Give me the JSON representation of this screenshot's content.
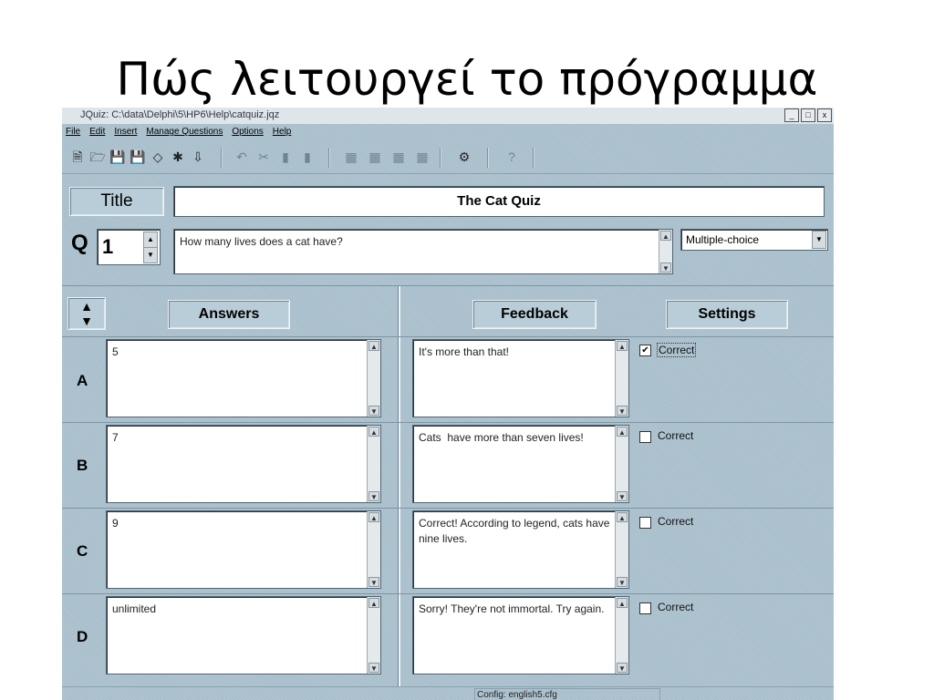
{
  "slide": {
    "title": "Πώς λειτουργεί το πρόγραμμα"
  },
  "window": {
    "title": "JQuiz: C:\\data\\Delphi\\5\\HP6\\Help\\catquiz.jqz",
    "controls": [
      "_",
      "□",
      "x"
    ]
  },
  "menu": [
    "File",
    "Edit",
    "Insert",
    "Manage Questions",
    "Options",
    "Help"
  ],
  "toolbar": [
    {
      "icon": "new-file-icon",
      "glyph": "🗎"
    },
    {
      "icon": "open-folder-icon",
      "glyph": "🗁"
    },
    {
      "icon": "save-icon",
      "glyph": "💾"
    },
    {
      "icon": "save-as-icon",
      "glyph": "💾"
    },
    {
      "icon": "eraser-icon",
      "glyph": "◇"
    },
    {
      "icon": "web-export-icon",
      "glyph": "✱"
    },
    {
      "icon": "download-icon",
      "glyph": "⇩"
    },
    {
      "icon": "undo-icon",
      "glyph": "↶"
    },
    {
      "icon": "cut-icon",
      "glyph": "✂"
    },
    {
      "icon": "copy-icon",
      "glyph": "▮"
    },
    {
      "icon": "paste-icon",
      "glyph": "▮"
    },
    {
      "icon": "add-question-icon",
      "glyph": "▦"
    },
    {
      "icon": "insert-question-icon",
      "glyph": "▦"
    },
    {
      "icon": "delete-question-icon",
      "glyph": "▦"
    },
    {
      "icon": "move-question-icon",
      "glyph": "▦"
    },
    {
      "icon": "config-icon",
      "glyph": "⚙"
    },
    {
      "icon": "help-icon",
      "glyph": "?"
    }
  ],
  "title_label": "Title",
  "title_value": "The Cat Quiz",
  "question": {
    "label": "Q",
    "number": "1",
    "text": "How many lives does a cat have?",
    "type": "Multiple-choice"
  },
  "headers": {
    "answers": "Answers",
    "feedback": "Feedback",
    "settings": "Settings"
  },
  "rows": [
    {
      "letter": "A",
      "answer": "5",
      "feedback": "It's more than that!",
      "correct_label": "Correct",
      "checked": true
    },
    {
      "letter": "B",
      "answer": "7",
      "feedback": "Cats  have more than seven lives!",
      "correct_label": "Correct",
      "checked": false
    },
    {
      "letter": "C",
      "answer": "9",
      "feedback": "Correct! According to legend, cats have nine lives.",
      "correct_label": "Correct",
      "checked": false
    },
    {
      "letter": "D",
      "answer": "unlimited",
      "feedback": "Sorry! They're not immortal. Try again.",
      "correct_label": "Correct",
      "checked": false
    }
  ],
  "status": {
    "config": "Config: english5.cfg"
  }
}
